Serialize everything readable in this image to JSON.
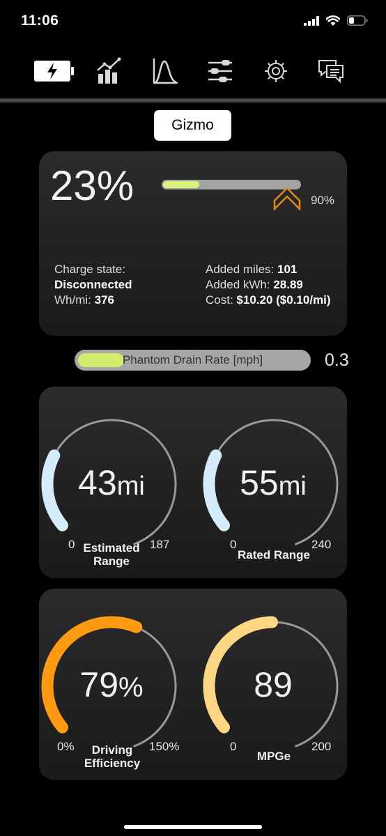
{
  "status_bar": {
    "time": "11:06"
  },
  "tabs": [
    {
      "icon": "battery-charging-icon",
      "active": true
    },
    {
      "icon": "bar-chart-trend-icon",
      "active": false
    },
    {
      "icon": "bell-curve-chart-icon",
      "active": false
    },
    {
      "icon": "sliders-icon",
      "active": false
    },
    {
      "icon": "gear-icon",
      "active": false
    },
    {
      "icon": "chat-bubbles-icon",
      "active": false
    }
  ],
  "vehicle_name": "Gizmo",
  "battery": {
    "percent_text": "23%",
    "percent": 23,
    "charge_limit_label": "90%",
    "charge_limit": 90,
    "charge_state_label": "Charge state:",
    "charge_state_value": "Disconnected",
    "wh_mi_label": "Wh/mi:",
    "wh_mi_value": "376",
    "added_miles_label": "Added miles:",
    "added_miles_value": "101",
    "added_kwh_label": "Added kWh:",
    "added_kwh_value": "28.89",
    "cost_label": "Cost:",
    "cost_value": "$10.20 ($0.10/mi)"
  },
  "phantom_drain": {
    "label": "Phantom Drain Rate [mph]",
    "value_text": "0.3",
    "level_fraction": 0.2
  },
  "gauges": {
    "estimated_range": {
      "value": "43",
      "unit": "mi",
      "label_line1": "Estimated",
      "label_line2": "Range",
      "min": "0",
      "max": "187",
      "fraction": 0.23
    },
    "rated_range": {
      "value": "55",
      "unit": "mi",
      "label_line1": "Rated Range",
      "label_line2": "",
      "min": "0",
      "max": "240",
      "fraction": 0.23
    },
    "driving_efficiency": {
      "value": "79",
      "unit": "%",
      "label_line1": "Driving",
      "label_line2": "Efficiency",
      "min": "0%",
      "max": "150%",
      "fraction": 0.527
    },
    "mpge": {
      "value": "89",
      "unit": "",
      "label_line1": "MPGe",
      "label_line2": "",
      "min": "0",
      "max": "200",
      "fraction": 0.445
    }
  },
  "colors": {
    "background": "#000000",
    "range_arc": "#d5ecfb",
    "efficiency_arc": "#ff9a12",
    "mpge_arc": "#ffd784",
    "track_arc": "#9a9a9a",
    "charge_fill": "#d9f27a",
    "limit_chevron": "#e08a1e"
  }
}
